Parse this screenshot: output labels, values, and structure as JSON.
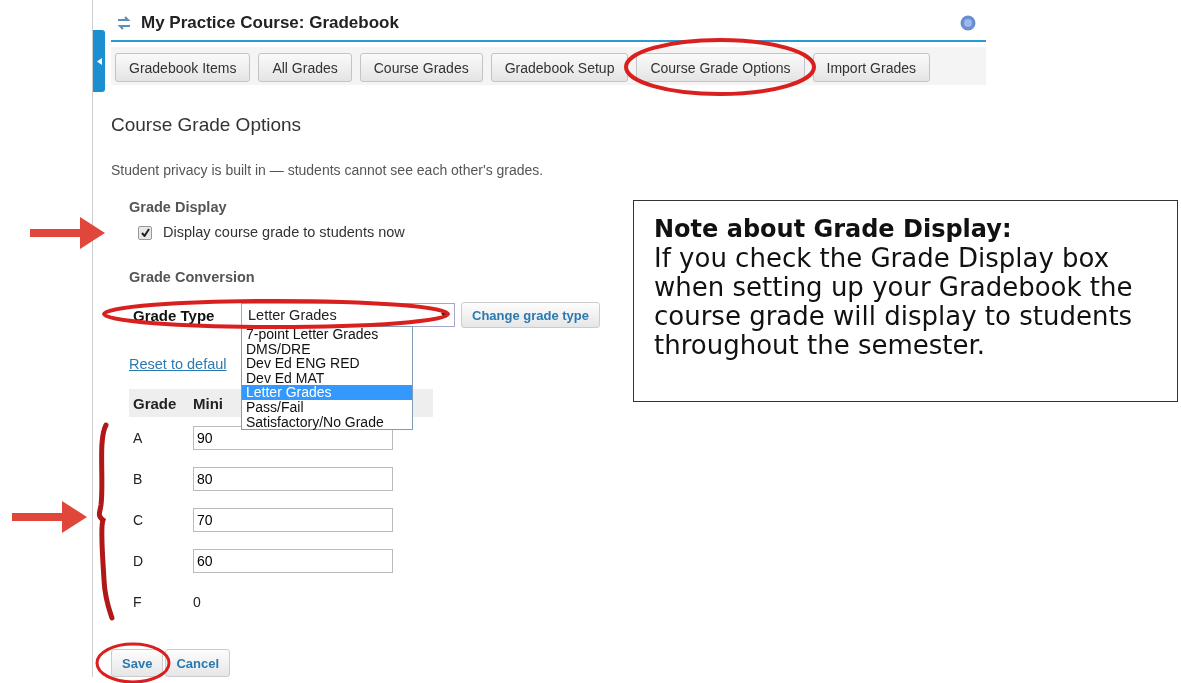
{
  "header": {
    "title": "My Practice Course: Gradebook"
  },
  "tabs": [
    {
      "label": "Gradebook Items"
    },
    {
      "label": "All Grades"
    },
    {
      "label": "Course Grades"
    },
    {
      "label": "Gradebook Setup"
    },
    {
      "label": "Course Grade Options"
    },
    {
      "label": "Import Grades"
    }
  ],
  "page_title": "Course Grade Options",
  "privacy_note": "Student privacy is built in — students cannot see each other's grades.",
  "grade_display": {
    "heading": "Grade Display",
    "checkbox": {
      "label": "Display course grade to students now",
      "checked": true
    }
  },
  "grade_conversion": {
    "heading": "Grade Conversion",
    "grade_type_label": "Grade Type",
    "grade_type_value": "Letter Grades",
    "change_button": "Change grade type",
    "reset_link": "Reset to defaul",
    "options": [
      {
        "label": "7-point Letter Grades",
        "selected": false
      },
      {
        "label": "DMS/DRE",
        "selected": false
      },
      {
        "label": "Dev Ed ENG RED",
        "selected": false
      },
      {
        "label": "Dev Ed MAT",
        "selected": false
      },
      {
        "label": "Letter Grades",
        "selected": true
      },
      {
        "label": "Pass/Fail",
        "selected": false
      },
      {
        "label": "Satisfactory/No Grade",
        "selected": false
      }
    ]
  },
  "table": {
    "columns": [
      "Grade",
      "Mini"
    ],
    "rows": [
      {
        "grade": "A",
        "kind": "input",
        "value": "90"
      },
      {
        "grade": "B",
        "kind": "input",
        "value": "80"
      },
      {
        "grade": "C",
        "kind": "input",
        "value": "70"
      },
      {
        "grade": "D",
        "kind": "input",
        "value": "60"
      },
      {
        "grade": "F",
        "kind": "fixed",
        "value": "0"
      }
    ]
  },
  "buttons": [
    "Save",
    "Cancel"
  ],
  "note": {
    "title": "Note about Grade Display:",
    "body": "If you check the Grade Display box when setting up your Gradebook the course grade will display to students throughout the semester."
  }
}
